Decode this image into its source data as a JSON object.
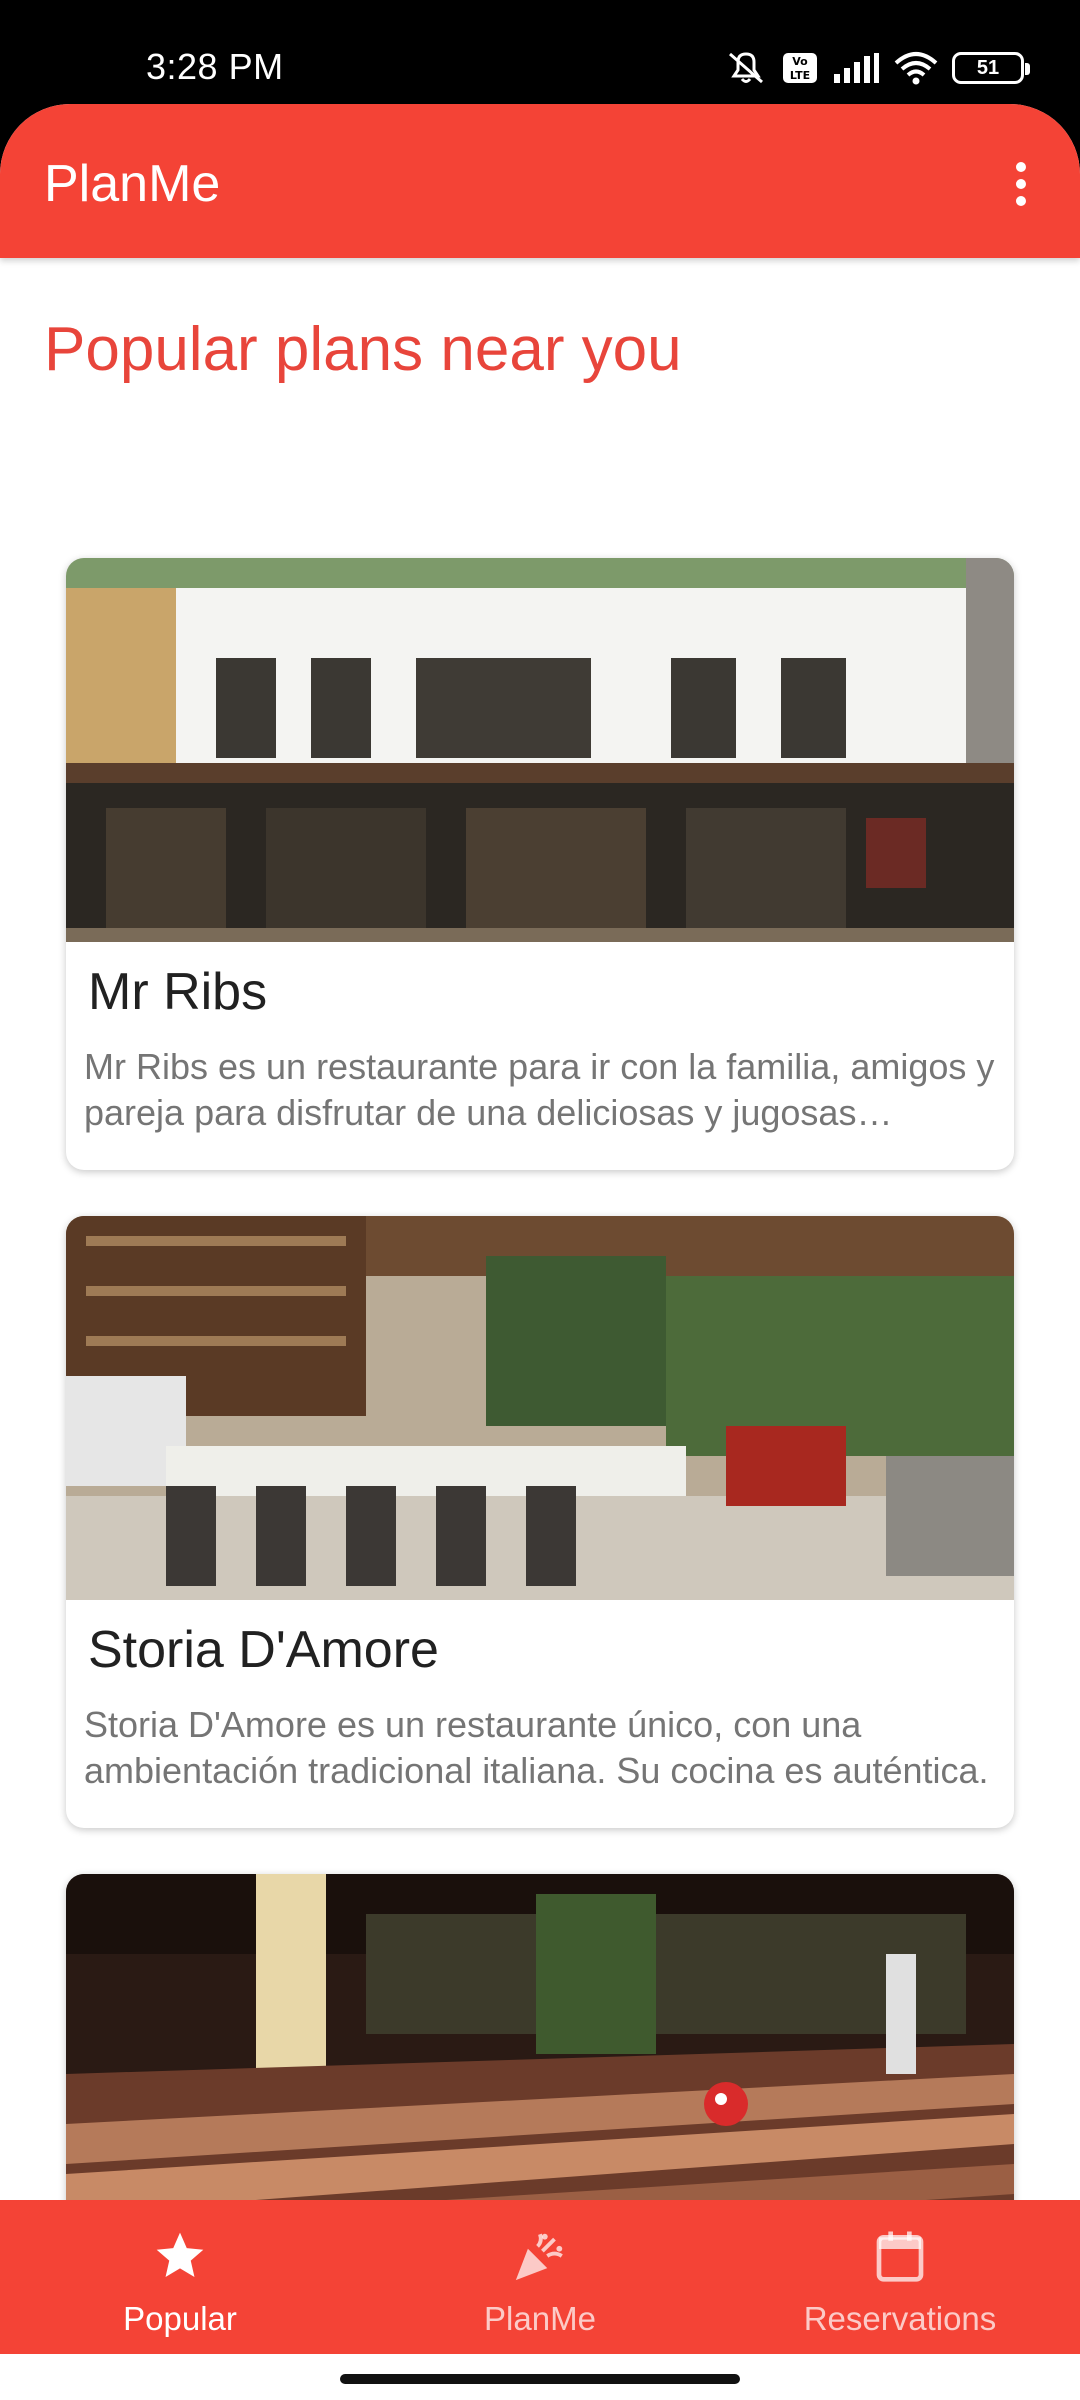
{
  "status_bar": {
    "time": "3:28 PM",
    "battery": "51",
    "icons": [
      "mute-icon",
      "volte-icon",
      "signal-icon",
      "wifi-icon",
      "battery-icon"
    ]
  },
  "app_bar": {
    "title": "PlanMe",
    "menu_icon": "more-vert-icon"
  },
  "main": {
    "section_title": "Popular plans near you",
    "cards": [
      {
        "title": "Mr Ribs",
        "description": "Mr Ribs es un restaurante para ir con la familia, amigos y pareja para disfrutar de una deliciosas y jugosas costillas."
      },
      {
        "title": "Storia D'Amore",
        "description": "Storia D'Amore es un restaurante único, con una ambientación tradicional italiana. Su cocina es auténtica."
      },
      {
        "title": "",
        "description": ""
      }
    ]
  },
  "bottom_nav": {
    "items": [
      {
        "label": "Popular",
        "icon": "star-icon",
        "active": true
      },
      {
        "label": "PlanMe",
        "icon": "celebration-icon",
        "active": false
      },
      {
        "label": "Reservations",
        "icon": "calendar-icon",
        "active": false
      }
    ]
  },
  "colors": {
    "primary": "#f44336",
    "section_title": "#e8453b",
    "card_title": "#212121",
    "card_desc": "#757575"
  }
}
